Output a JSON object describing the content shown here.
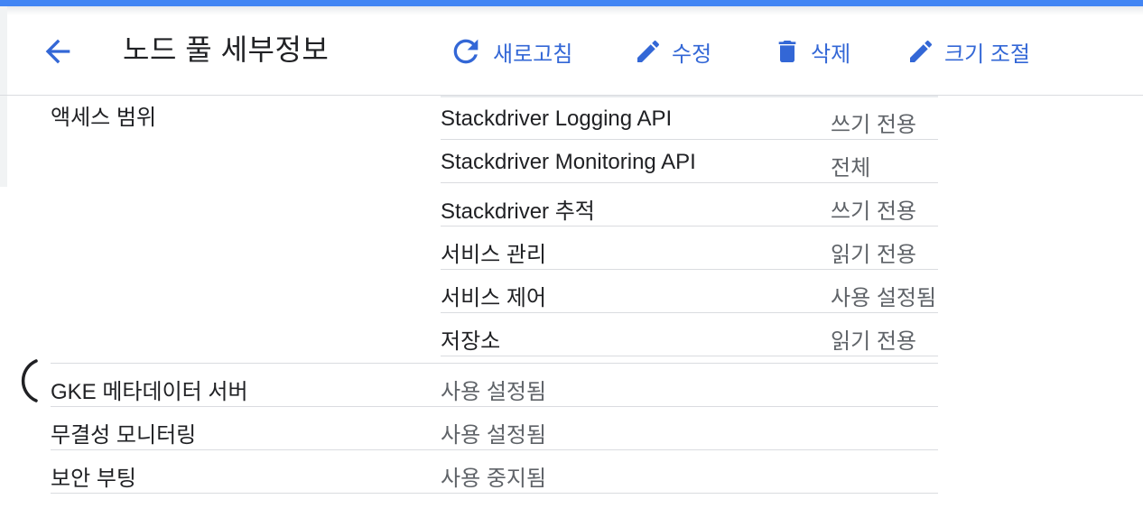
{
  "header": {
    "title": "노드 풀 세부정보",
    "actions": {
      "refresh": "새로고침",
      "edit": "수정",
      "delete": "삭제",
      "resize": "크기 조절"
    }
  },
  "access_scopes": {
    "label": "액세스 범위",
    "rows": [
      {
        "name": "Stackdriver Logging API",
        "value": "쓰기 전용"
      },
      {
        "name": "Stackdriver Monitoring API",
        "value": "전체"
      },
      {
        "name": "Stackdriver 추적",
        "value": "쓰기 전용"
      },
      {
        "name": "서비스 관리",
        "value": "읽기 전용"
      },
      {
        "name": "서비스 제어",
        "value": "사용 설정됨"
      },
      {
        "name": "저장소",
        "value": "읽기 전용"
      }
    ]
  },
  "properties": [
    {
      "label": "GKE 메타데이터 서버",
      "value": "사용 설정됨"
    },
    {
      "label": "무결성 모니터링",
      "value": "사용 설정됨"
    },
    {
      "label": "보안 부팅",
      "value": "사용 중지됨"
    }
  ],
  "colors": {
    "accent": "#4285f4",
    "action": "#3367d6",
    "divider": "#dadce0",
    "secondary_text": "#5f6368"
  },
  "icons": {
    "back": "arrow-back-icon",
    "refresh": "refresh-icon",
    "edit": "pencil-icon",
    "delete": "trash-icon",
    "resize": "pencil-icon"
  }
}
